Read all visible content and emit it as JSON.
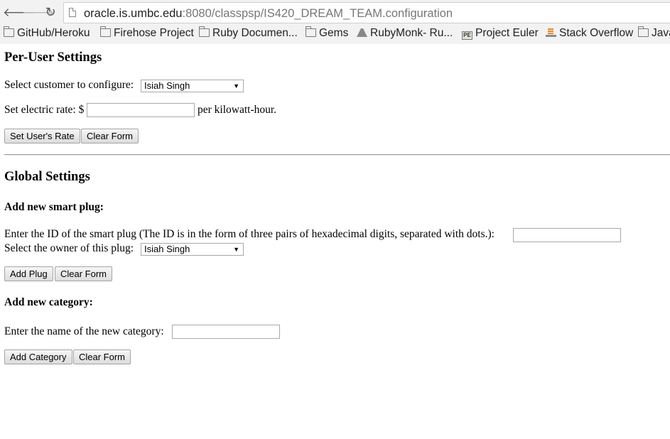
{
  "browser": {
    "url_host": "oracle.is.umbc.edu",
    "url_rest": ":8080/classpsp/IS420_DREAM_TEAM.configuration",
    "bookmarks": [
      {
        "label": "GitHub/Heroku",
        "icon": "folder-icon"
      },
      {
        "label": "Firehose Project",
        "icon": "folder-icon"
      },
      {
        "label": "Ruby Documen...",
        "icon": "folder-icon"
      },
      {
        "label": "Gems",
        "icon": "folder-icon"
      },
      {
        "label": "RubyMonk- Ru...",
        "icon": "rubymonk-icon"
      },
      {
        "label": "Project Euler",
        "icon": "project-euler-icon"
      },
      {
        "label": "Stack Overflow",
        "icon": "stack-overflow-icon"
      },
      {
        "label": "Java",
        "icon": "folder-icon"
      }
    ]
  },
  "per_user": {
    "heading": "Per-User Settings",
    "customer_label": "Select customer to configure:",
    "customer_selected": "Isiah Singh",
    "rate_label": "Set electric rate: $",
    "rate_value": "",
    "rate_suffix": "per kilowatt-hour.",
    "set_rate_button": "Set User's Rate",
    "clear_button": "Clear Form"
  },
  "global": {
    "heading": "Global Settings",
    "add_plug": {
      "heading": "Add new smart plug:",
      "id_label": "Enter the ID of the smart plug (The ID is in the form of three pairs of hexadecimal digits, separated with dots.):",
      "id_value": "",
      "owner_label": "Select the owner of this plug:",
      "owner_selected": "Isiah Singh",
      "add_button": "Add Plug",
      "clear_button": "Clear Form"
    },
    "add_category": {
      "heading": "Add new category:",
      "name_label": "Enter the name of the new category:",
      "name_value": "",
      "add_button": "Add Category",
      "clear_button": "Clear Form"
    }
  }
}
